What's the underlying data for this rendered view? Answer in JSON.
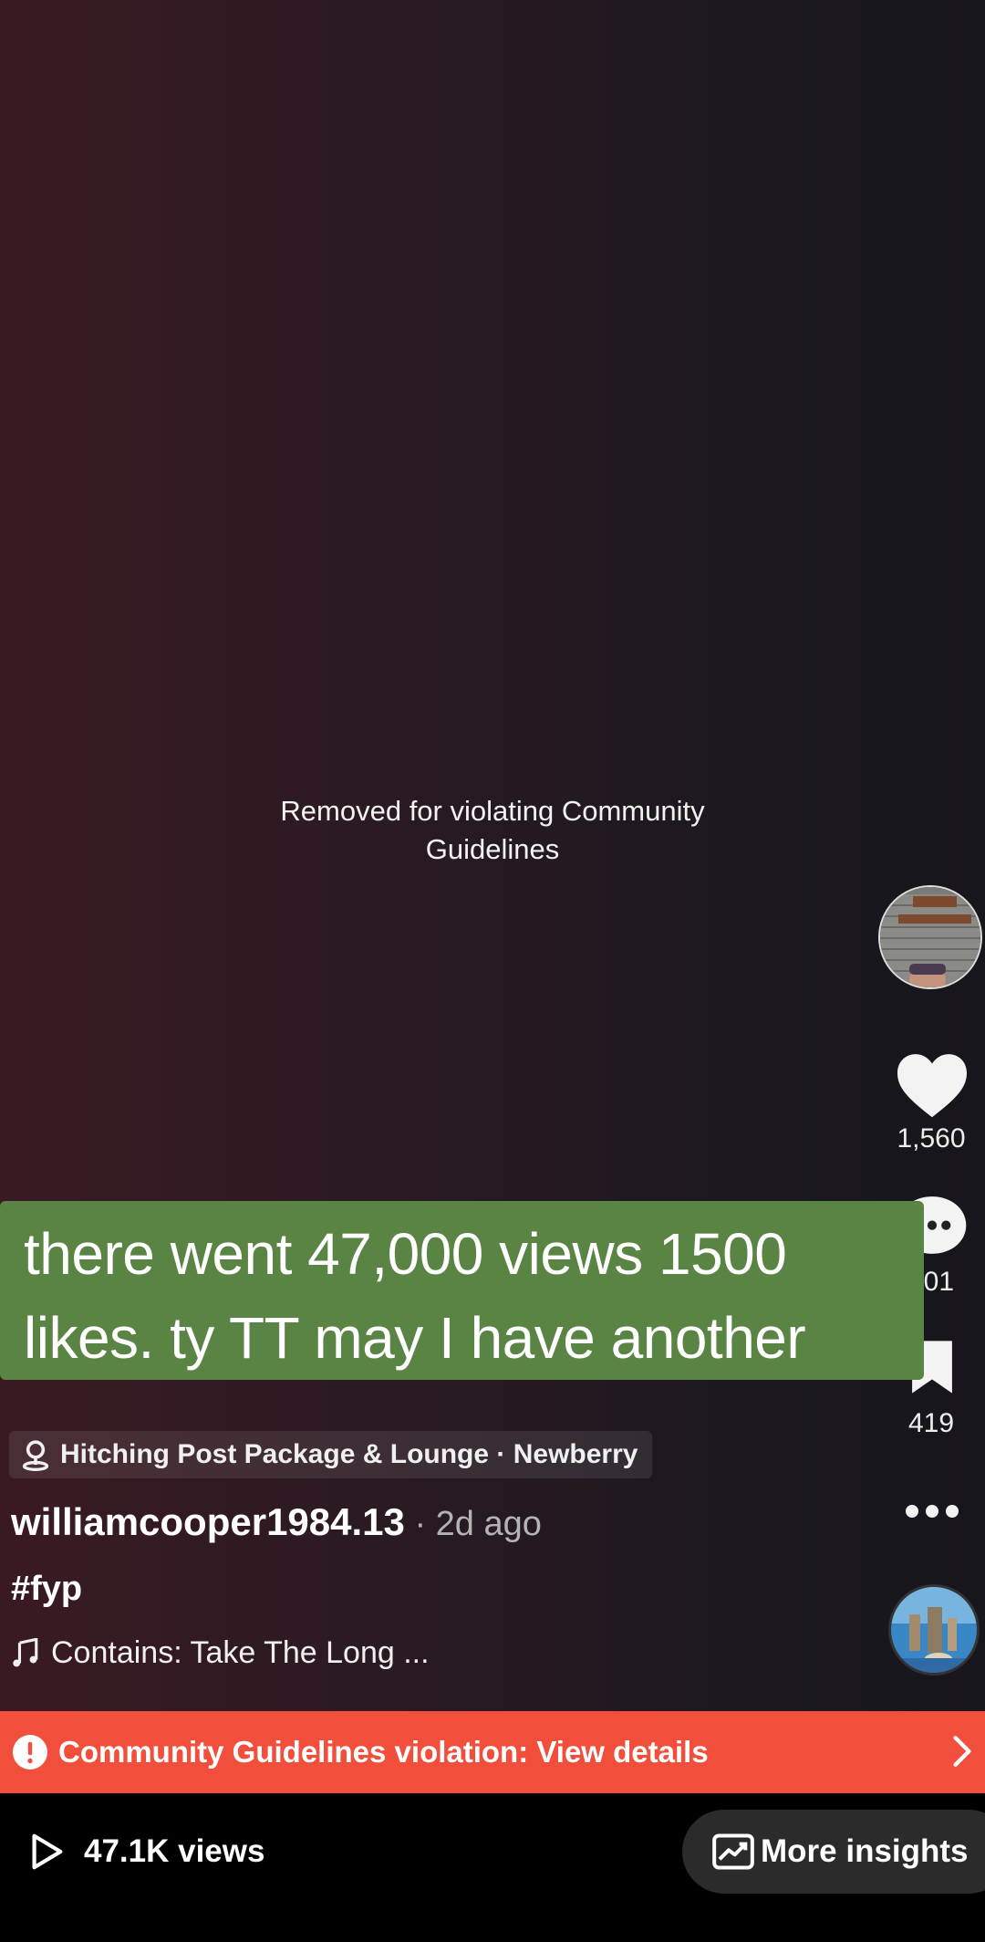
{
  "video": {
    "removed_notice": "Removed for violating Community Guidelines",
    "caption_line1": "there went 47,000 views 1500",
    "caption_line2": "likes. ty TT may I have another"
  },
  "actions": {
    "likes": "1,560",
    "comments": "101",
    "saves": "419"
  },
  "post": {
    "location": "Hitching Post Package & Lounge · Newberry",
    "username": "williamcooper1984.13",
    "time": " · 2d ago",
    "hashtag": "#fyp",
    "music": "Contains: Take The Long ..."
  },
  "violation": {
    "label": "Community Guidelines violation: View details"
  },
  "footer": {
    "views": "47.1K views",
    "insights": "More insights"
  },
  "colors": {
    "caption_bg": "#5a8444",
    "violation_bg": "#f14e3c",
    "insights_bg": "#2b2b2b"
  },
  "icons": [
    "heart-icon",
    "comment-icon",
    "bookmark-icon",
    "more-icon",
    "location-pin-icon",
    "music-note-icon",
    "alert-icon",
    "chevron-right-icon",
    "play-icon",
    "chart-icon"
  ]
}
